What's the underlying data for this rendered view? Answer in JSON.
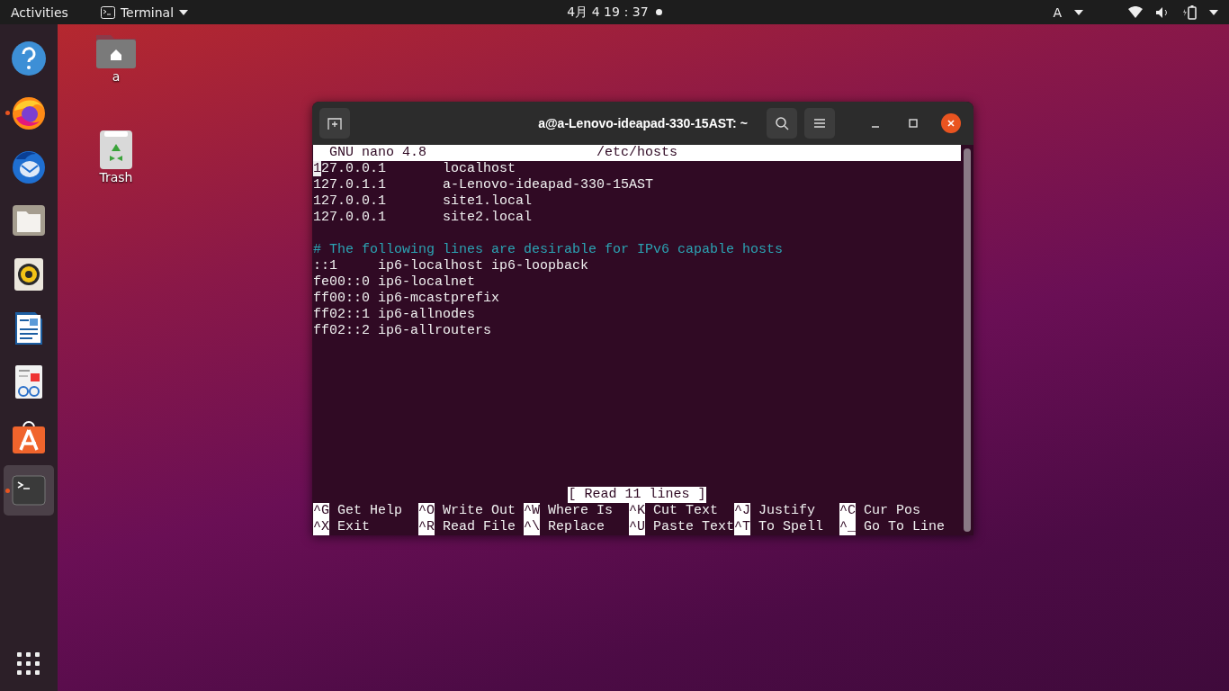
{
  "top_bar": {
    "activities": "Activities",
    "app_menu": "Terminal",
    "clock": "4月 4 19：37",
    "keyboard": "A"
  },
  "dock": [
    {
      "kind": "help",
      "running": false,
      "selected": false
    },
    {
      "kind": "firefox",
      "running": true,
      "selected": false
    },
    {
      "kind": "mail",
      "running": false,
      "selected": false
    },
    {
      "kind": "files",
      "running": false,
      "selected": false
    },
    {
      "kind": "speaker",
      "running": false,
      "selected": false
    },
    {
      "kind": "writer",
      "running": false,
      "selected": false
    },
    {
      "kind": "viewer",
      "running": false,
      "selected": false
    },
    {
      "kind": "store",
      "running": false,
      "selected": false
    },
    {
      "kind": "terminal",
      "running": true,
      "selected": true
    }
  ],
  "desktop_icons": [
    {
      "kind": "home",
      "label": "a"
    },
    {
      "kind": "trash",
      "label": "Trash"
    }
  ],
  "window": {
    "title": "a@a-Lenovo-ideapad-330-15AST: ~",
    "nano": {
      "version": "GNU nano 4.8",
      "file": "/etc/hosts",
      "lines": [
        {
          "kind": "text",
          "text": "127.0.0.1       localhost",
          "cursor": true
        },
        {
          "kind": "text",
          "text": "127.0.1.1       a-Lenovo-ideapad-330-15AST",
          "cursor": false
        },
        {
          "kind": "text",
          "text": "127.0.0.1       site1.local",
          "cursor": false
        },
        {
          "kind": "text",
          "text": "127.0.0.1       site2.local",
          "cursor": false
        },
        {
          "kind": "blank",
          "cursor": false
        },
        {
          "kind": "comment",
          "text": "# The following lines are desirable for IPv6 capable hosts",
          "cursor": false
        },
        {
          "kind": "text",
          "text": "::1     ip6-localhost ip6-loopback",
          "cursor": false
        },
        {
          "kind": "text",
          "text": "fe00::0 ip6-localnet",
          "cursor": false
        },
        {
          "kind": "text",
          "text": "ff00::0 ip6-mcastprefix",
          "cursor": false
        },
        {
          "kind": "text",
          "text": "ff02::1 ip6-allnodes",
          "cursor": false
        },
        {
          "kind": "text",
          "text": "ff02::2 ip6-allrouters",
          "cursor": false
        }
      ],
      "status": "[ Read 11 lines ]",
      "shortcuts": [
        [
          {
            "key": "^G",
            "label": "Get Help"
          },
          {
            "key": "^O",
            "label": "Write Out"
          },
          {
            "key": "^W",
            "label": "Where Is"
          },
          {
            "key": "^K",
            "label": "Cut Text"
          },
          {
            "key": "^J",
            "label": "Justify"
          },
          {
            "key": "^C",
            "label": "Cur Pos"
          }
        ],
        [
          {
            "key": "^X",
            "label": "Exit"
          },
          {
            "key": "^R",
            "label": "Read File"
          },
          {
            "key": "^\\",
            "label": "Replace"
          },
          {
            "key": "^U",
            "label": "Paste Text"
          },
          {
            "key": "^T",
            "label": "To Spell"
          },
          {
            "key": "^_",
            "label": "Go To Line"
          }
        ]
      ]
    }
  }
}
